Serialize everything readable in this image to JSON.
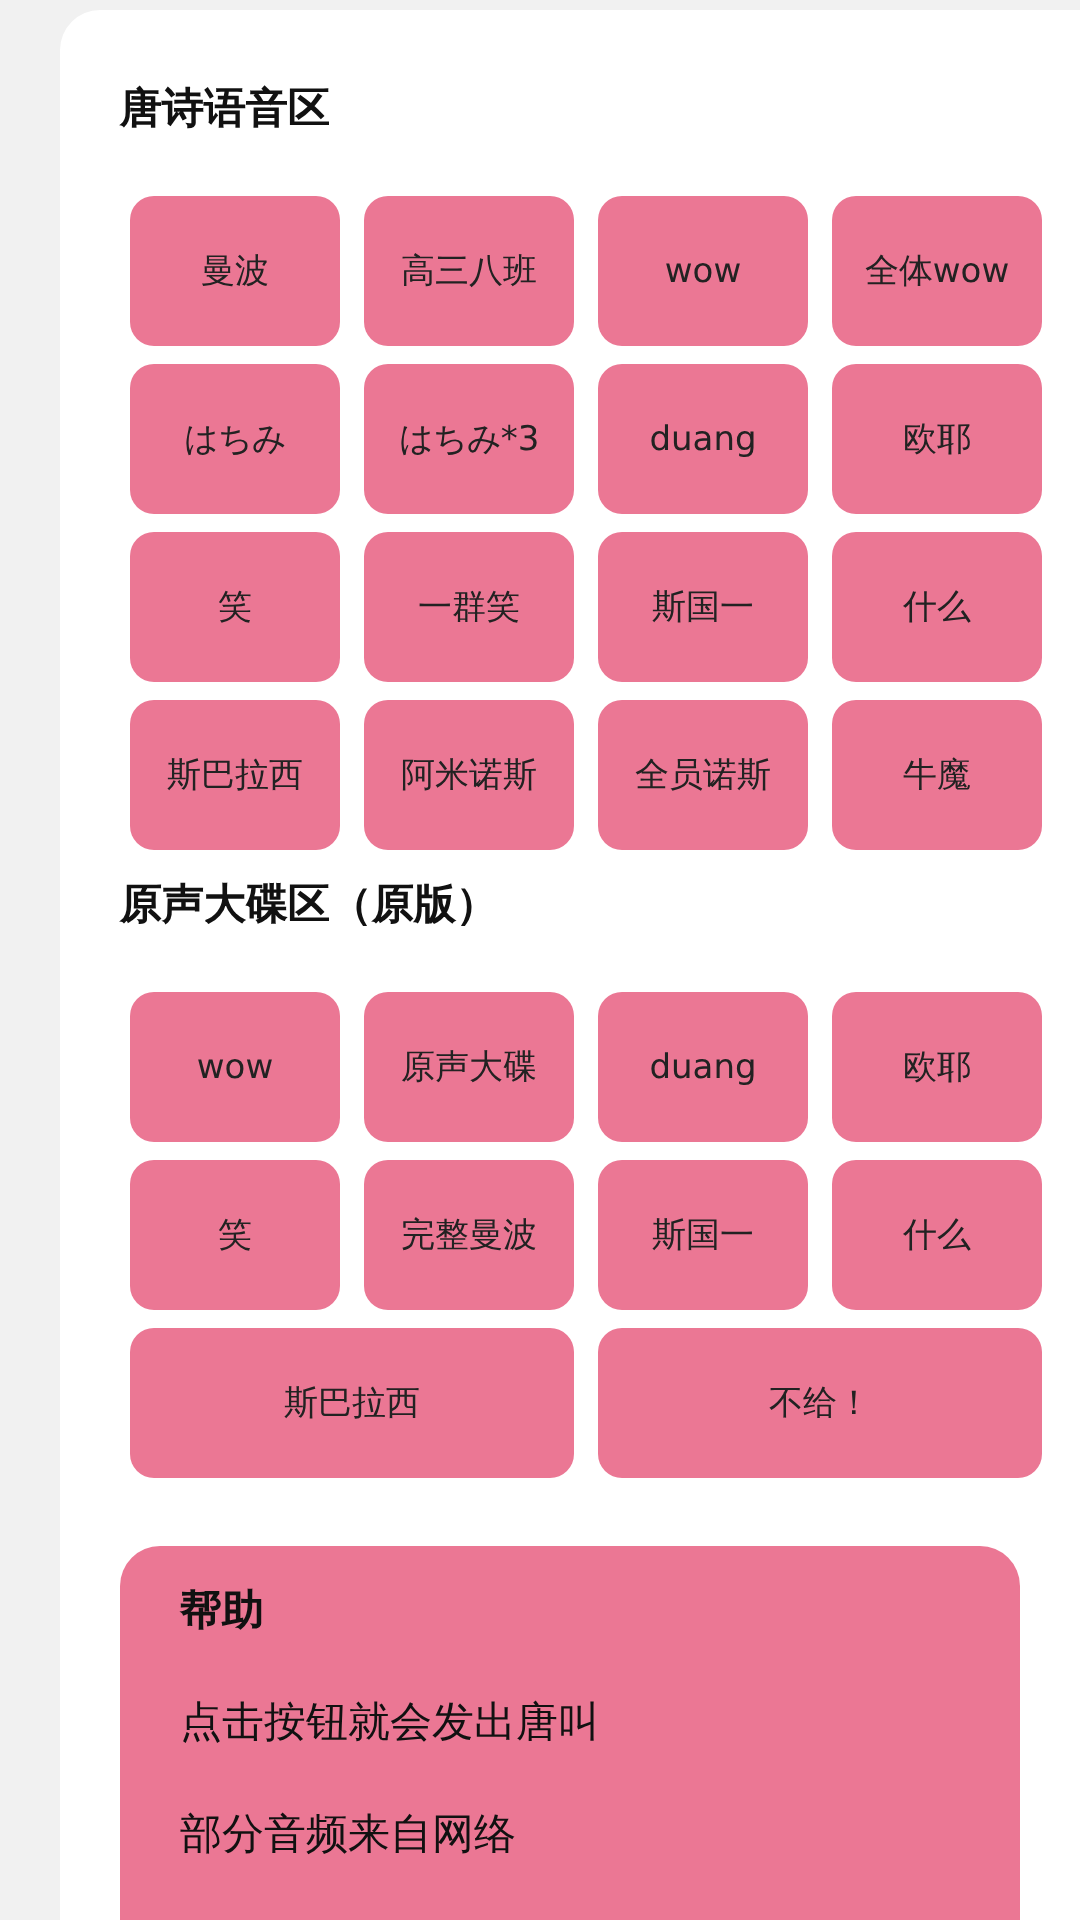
{
  "sections": [
    {
      "title": "唐诗语音区",
      "buttons": [
        {
          "label": "曼波",
          "kind": "normal"
        },
        {
          "label": "高三八班",
          "kind": "normal"
        },
        {
          "label": "wow",
          "kind": "normal"
        },
        {
          "label": "全体wow",
          "kind": "normal"
        },
        {
          "label": "はちみ",
          "kind": "normal"
        },
        {
          "label": "はちみ*3",
          "kind": "normal"
        },
        {
          "label": "duang",
          "kind": "normal"
        },
        {
          "label": "欧耶",
          "kind": "normal"
        },
        {
          "label": "笑",
          "kind": "normal"
        },
        {
          "label": "一群笑",
          "kind": "normal"
        },
        {
          "label": "斯国一",
          "kind": "normal"
        },
        {
          "label": "什么",
          "kind": "normal"
        },
        {
          "label": "斯巴拉西",
          "kind": "normal"
        },
        {
          "label": "阿米诺斯",
          "kind": "normal"
        },
        {
          "label": "全员诺斯",
          "kind": "normal"
        },
        {
          "label": "牛魔",
          "kind": "normal"
        }
      ]
    },
    {
      "title": "原声大碟区（原版）",
      "buttons": [
        {
          "label": "wow",
          "kind": "normal"
        },
        {
          "label": "原声大碟",
          "kind": "normal"
        },
        {
          "label": "duang",
          "kind": "normal"
        },
        {
          "label": "欧耶",
          "kind": "normal"
        },
        {
          "label": "笑",
          "kind": "normal"
        },
        {
          "label": "完整曼波",
          "kind": "normal"
        },
        {
          "label": "斯国一",
          "kind": "normal"
        },
        {
          "label": "什么",
          "kind": "normal"
        },
        {
          "label": "斯巴拉西",
          "kind": "wide"
        },
        {
          "label": "不给！",
          "kind": "wide"
        }
      ]
    }
  ],
  "help": {
    "title": "帮助",
    "lines": [
      "点击按钮就会发出唐叫",
      "部分音频来自网络"
    ]
  }
}
